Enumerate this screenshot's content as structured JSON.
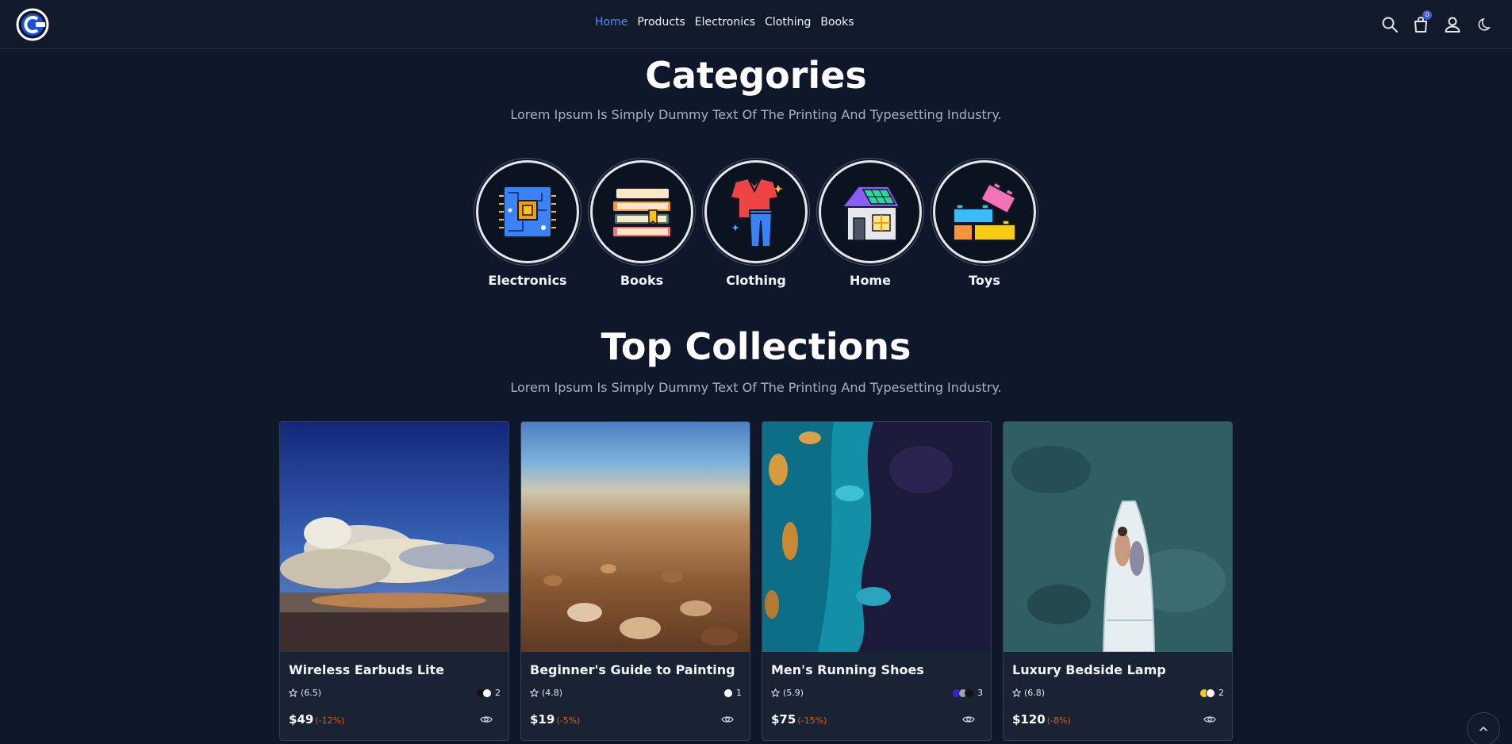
{
  "header": {
    "nav": [
      {
        "label": "Home",
        "active": true
      },
      {
        "label": "Products",
        "active": false
      },
      {
        "label": "Electronics",
        "active": false
      },
      {
        "label": "Clothing",
        "active": false
      },
      {
        "label": "Books",
        "active": false
      }
    ],
    "cart_count": "0",
    "icons": [
      "search-icon",
      "cart-icon",
      "user-icon",
      "moon-icon"
    ]
  },
  "categories_section": {
    "title": "Categories",
    "subtitle": "Lorem Ipsum Is Simply Dummy Text Of The Printing And Typesetting Industry.",
    "items": [
      {
        "label": "Electronics",
        "icon": "circuit-board-icon"
      },
      {
        "label": "Books",
        "icon": "books-stack-icon"
      },
      {
        "label": "Clothing",
        "icon": "clothes-icon"
      },
      {
        "label": "Home",
        "icon": "house-icon"
      },
      {
        "label": "Toys",
        "icon": "toy-blocks-icon"
      }
    ]
  },
  "collections_section": {
    "title": "Top Collections",
    "subtitle": "Lorem Ipsum Is Simply Dummy Text Of The Printing And Typesetting Industry.",
    "products": [
      {
        "name": "Wireless Earbuds Lite",
        "rating": "(6.5)",
        "color_count": "2",
        "colors": [
          "#111111",
          "#ffffff"
        ],
        "price": "$49",
        "discount": "(-12%)"
      },
      {
        "name": "Beginner's Guide to Painting",
        "rating": "(4.8)",
        "color_count": "1",
        "colors": [
          "#ffffff"
        ],
        "price": "$19",
        "discount": "(-5%)"
      },
      {
        "name": "Men's Running Shoes",
        "rating": "(5.9)",
        "color_count": "3",
        "colors": [
          "#3b1fd9",
          "#9ca3af",
          "#111111"
        ],
        "price": "$75",
        "discount": "(-15%)"
      },
      {
        "name": "Luxury Bedside Lamp",
        "rating": "(6.8)",
        "color_count": "2",
        "colors": [
          "#facc15",
          "#ffffff"
        ],
        "price": "$120",
        "discount": "(-8%)"
      }
    ]
  }
}
